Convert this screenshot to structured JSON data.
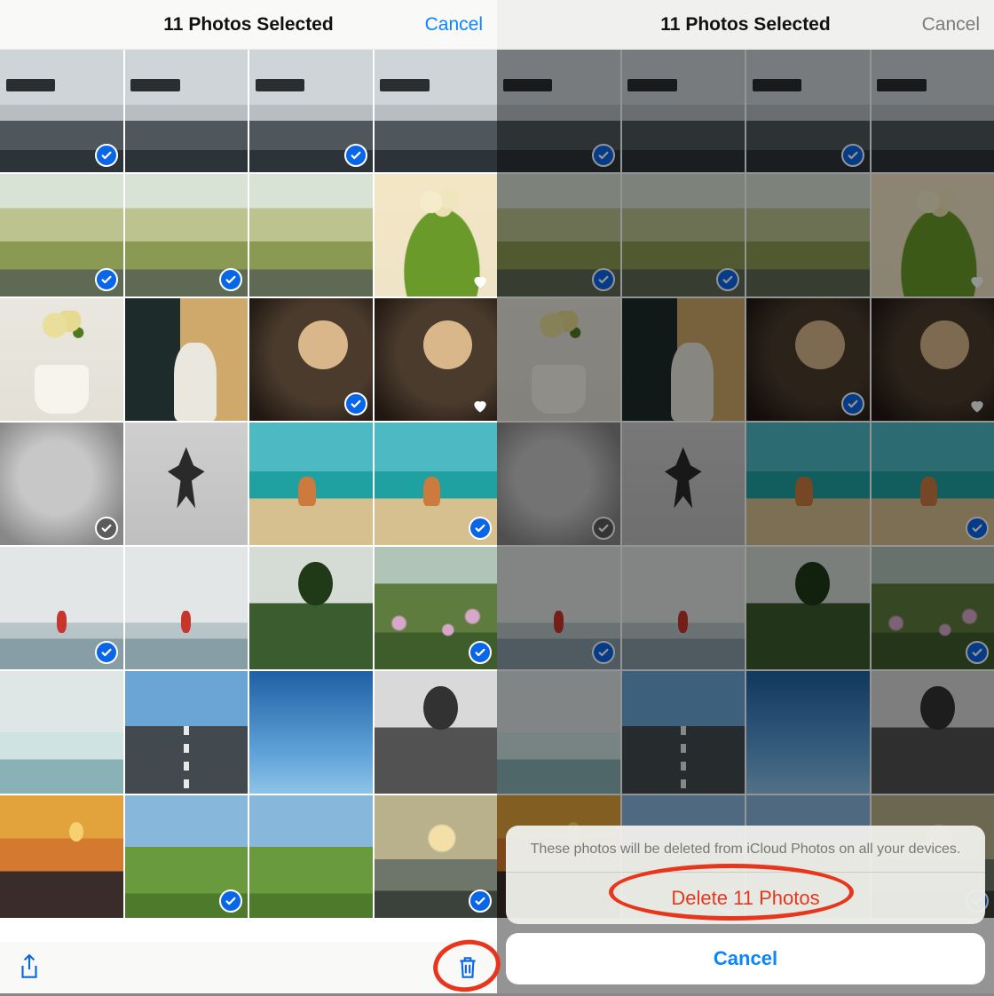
{
  "colors": {
    "accent": "#0a84ff",
    "destructive": "#e8361c",
    "selection": "#0a66e8"
  },
  "left": {
    "title": "11 Photos Selected",
    "cancel": "Cancel",
    "toolbar": {
      "share": "share-icon",
      "trash": "trash-icon"
    }
  },
  "right": {
    "title": "11 Photos Selected",
    "cancel": "Cancel"
  },
  "sheet": {
    "message": "These photos will be deleted from iCloud Photos on all your devices.",
    "delete": "Delete 11 Photos",
    "cancel": "Cancel"
  },
  "grid": [
    {
      "id": 0,
      "art": "sea-bw",
      "selected": true,
      "favorite": false
    },
    {
      "id": 1,
      "art": "sea-bw",
      "selected": false,
      "favorite": false
    },
    {
      "id": 2,
      "art": "sea-bw",
      "selected": true,
      "favorite": false
    },
    {
      "id": 3,
      "art": "sea-bw",
      "selected": false,
      "favorite": false
    },
    {
      "id": 4,
      "art": "field",
      "selected": true,
      "favorite": false
    },
    {
      "id": 5,
      "art": "field",
      "selected": true,
      "favorite": false
    },
    {
      "id": 6,
      "art": "field",
      "selected": false,
      "favorite": false
    },
    {
      "id": 7,
      "art": "tulips",
      "selected": false,
      "favorite": true
    },
    {
      "id": 8,
      "art": "vase-tulip",
      "selected": false,
      "favorite": false
    },
    {
      "id": 9,
      "art": "dog-door",
      "selected": false,
      "favorite": false
    },
    {
      "id": 10,
      "art": "rocks",
      "selected": true,
      "favorite": false
    },
    {
      "id": 11,
      "art": "rocks",
      "selected": false,
      "favorite": true
    },
    {
      "id": 12,
      "art": "kid-bw",
      "selected": true,
      "favorite": false
    },
    {
      "id": 13,
      "art": "jump-bw",
      "selected": false,
      "favorite": false
    },
    {
      "id": 14,
      "art": "beach",
      "selected": false,
      "favorite": false
    },
    {
      "id": 15,
      "art": "beach",
      "selected": true,
      "favorite": false
    },
    {
      "id": 16,
      "art": "lone",
      "selected": true,
      "favorite": false
    },
    {
      "id": 17,
      "art": "lone",
      "selected": false,
      "favorite": false
    },
    {
      "id": 18,
      "art": "tree-hill",
      "selected": false,
      "favorite": false
    },
    {
      "id": 19,
      "art": "wildflowers",
      "selected": true,
      "favorite": false
    },
    {
      "id": 20,
      "art": "sea-wave",
      "selected": false,
      "favorite": false
    },
    {
      "id": 21,
      "art": "road",
      "selected": false,
      "favorite": false
    },
    {
      "id": 22,
      "art": "sky-blue",
      "selected": false,
      "favorite": false
    },
    {
      "id": 23,
      "art": "tree-hill tree-bw",
      "selected": false,
      "favorite": false
    },
    {
      "id": 24,
      "art": "sunset",
      "selected": false,
      "favorite": false
    },
    {
      "id": 25,
      "art": "farm",
      "selected": true,
      "favorite": false
    },
    {
      "id": 26,
      "art": "farm",
      "selected": false,
      "favorite": false
    },
    {
      "id": 27,
      "art": "sea-glow",
      "selected": true,
      "favorite": false
    }
  ]
}
